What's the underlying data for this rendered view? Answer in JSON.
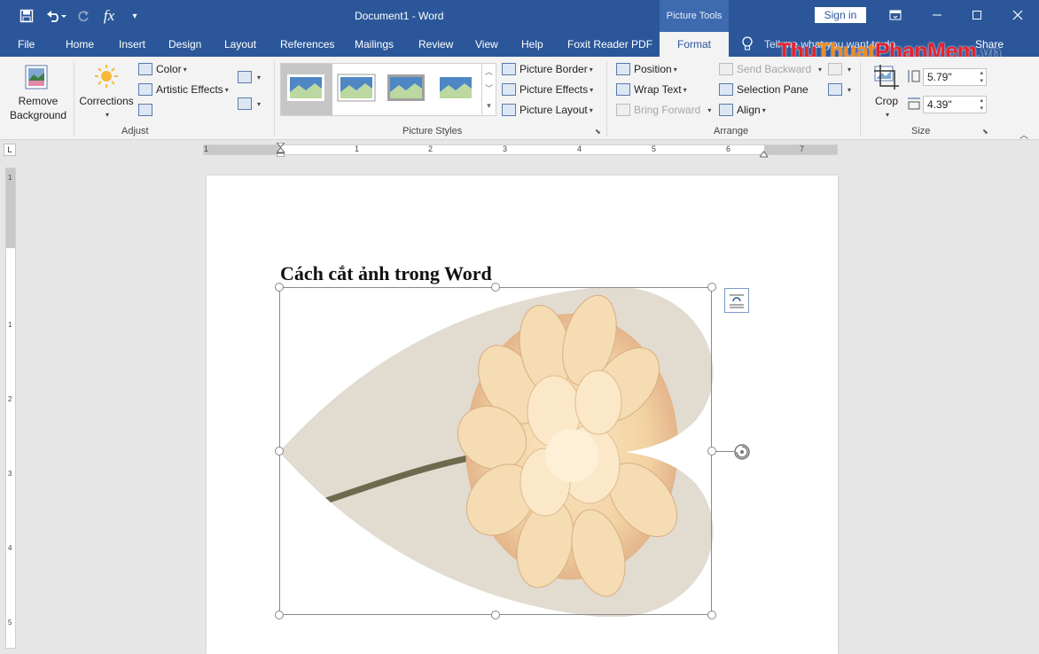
{
  "titlebar": {
    "document_title": "Document1  -  Word",
    "context_tab_group": "Picture Tools",
    "sign_in": "Sign in",
    "qat": [
      "save-icon",
      "undo-icon",
      "redo-icon",
      "function-icon",
      "customize-icon"
    ],
    "window_controls": [
      "ribbon-display-icon",
      "minimize-icon",
      "restore-icon",
      "close-icon"
    ]
  },
  "tabs": [
    "File",
    "Home",
    "Insert",
    "Design",
    "Layout",
    "References",
    "Mailings",
    "Review",
    "View",
    "Help",
    "Foxit Reader PDF",
    "Format"
  ],
  "active_tab": "Format",
  "tell_me": "Tell me what you want to do",
  "share": "Share",
  "watermark": {
    "part1": "Thu",
    "part2": "Thuat",
    "part3": "PhanMem",
    ".vn": ".vn"
  },
  "ribbon": {
    "adjust": {
      "label": "Adjust",
      "remove_background_line1": "Remove",
      "remove_background_line2": "Background",
      "corrections": "Corrections",
      "color": "Color",
      "artistic_effects": "Artistic Effects"
    },
    "picture_styles": {
      "label": "Picture Styles",
      "picture_border": "Picture Border",
      "picture_effects": "Picture Effects",
      "picture_layout": "Picture Layout"
    },
    "arrange": {
      "label": "Arrange",
      "position": "Position",
      "wrap_text": "Wrap Text",
      "bring_forward": "Bring Forward",
      "send_backward": "Send Backward",
      "selection_pane": "Selection Pane",
      "align": "Align"
    },
    "size": {
      "label": "Size",
      "crop": "Crop",
      "height": "5.79\"",
      "width": "4.39\""
    }
  },
  "ruler": {
    "horizontal_numbers": [
      "1",
      "1",
      "2",
      "3",
      "4",
      "5",
      "6",
      "7"
    ],
    "vertical_numbers": [
      "1",
      "1",
      "2",
      "3",
      "4",
      "5"
    ]
  },
  "document": {
    "heading": "Cách cắt ảnh trong Word"
  },
  "colors": {
    "accent": "#2b579a",
    "heart_bg": "#e2dbd0",
    "flower": "#f2d7ad"
  }
}
